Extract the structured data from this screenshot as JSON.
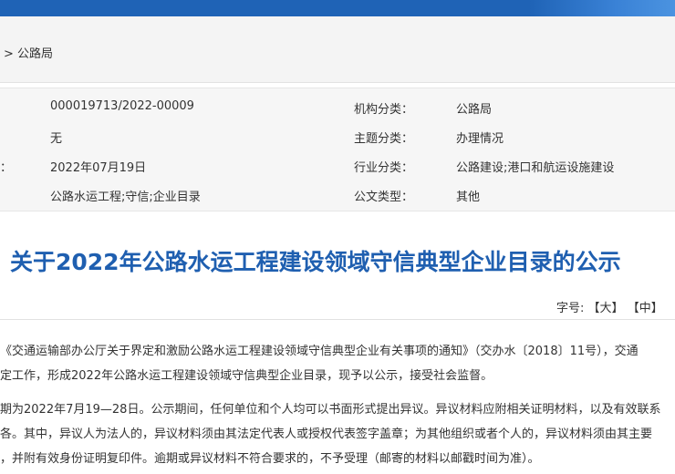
{
  "breadcrumb": {
    "text": "> 公路局"
  },
  "meta": {
    "index_no": "000019713/2022-00009",
    "doc_no": "无",
    "date_label": "：",
    "date": "2022年07月19日",
    "keywords": "公路水运工程;守信;企业目录",
    "org_label": "机构分类：",
    "org": "公路局",
    "topic_label": "主题分类：",
    "topic": "办理情况",
    "industry_label": "行业分类：",
    "industry": "公路建设;港口和航运设施建设",
    "doctype_label": "公文类型：",
    "doctype": "其他"
  },
  "article": {
    "title": "关于2022年公路水运工程建设领域守信典型企业目录的公示",
    "font_size_label": "字号:",
    "font_large": "【大】",
    "font_medium": "【中】",
    "para1_line1": "《交通运输部办公厅关于界定和激励公路水运工程建设领域守信典型企业有关事项的通知》（交办水〔2018〕11号），交通",
    "para1_line2": "定工作，形成2022年公路水运工程建设领域守信典型企业目录，现予以公示，接受社会监督。",
    "para2_line1": "期为2022年7月19—28日。公示期间，任何单位和个人均可以书面形式提出异议。异议材料应附相关证明材料，以及有效联系",
    "para2_line2": "各。其中，异议人为法人的，异议材料须由其法定代表人或授权代表签字盖章；为其他组织或者个人的，异议材料须由其主要",
    "para2_line3": "，并附有效身份证明复印件。逾期或异议材料不符合要求的，不予受理（邮寄的材料以邮戳时间为准）。"
  }
}
